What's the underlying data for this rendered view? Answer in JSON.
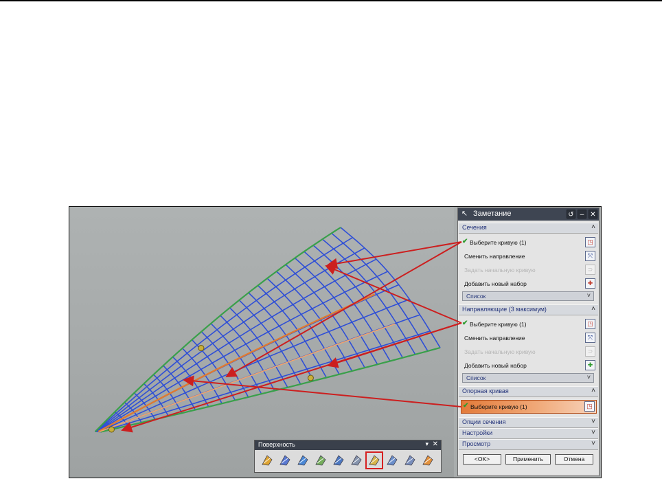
{
  "dialog": {
    "title": "Заметание",
    "sections": {
      "sections_head": "Сечения",
      "guides_head": "Направляющие (3 максимум)",
      "spine_head": "Опорная кривая",
      "options_head": "Опции сечения",
      "settings_head": "Настройки",
      "preview_head": "Просмотр"
    },
    "sections_rows": {
      "select_curve": "Выберите кривую (1)",
      "reverse_direction": "Сменить направление",
      "specify_origin_curve": "Задать начальную кривую",
      "add_new_set": "Добавить новый набор",
      "list": "Список"
    },
    "guides_rows": {
      "select_curve": "Выберите кривую (1)",
      "reverse_direction": "Сменить направление",
      "specify_origin_curve": "Задать начальную кривую",
      "add_new_set": "Добавить новый набор",
      "list": "Список"
    },
    "spine_rows": {
      "select_curve": "Выберите кривую (1)"
    },
    "buttons": {
      "ok": "<OK>",
      "apply": "Применить",
      "cancel": "Отмена"
    }
  },
  "toolbar": {
    "title": "Поверхность",
    "tools": [
      "extrude-surface-icon",
      "through-curves-icon",
      "through-mesh-icon",
      "swept-section-icon",
      "n-sided-icon",
      "law-extension-icon",
      "swept-icon",
      "variational-sweep-icon",
      "ruled-icon",
      "bounded-plane-icon"
    ],
    "selected_tool": "swept-icon"
  },
  "colors": {
    "mesh": "#2f4fd6",
    "edge": "#3aa04a",
    "guide": "#e07a30",
    "arrow": "#cc1f1f",
    "active_row": "#e37b3a"
  }
}
